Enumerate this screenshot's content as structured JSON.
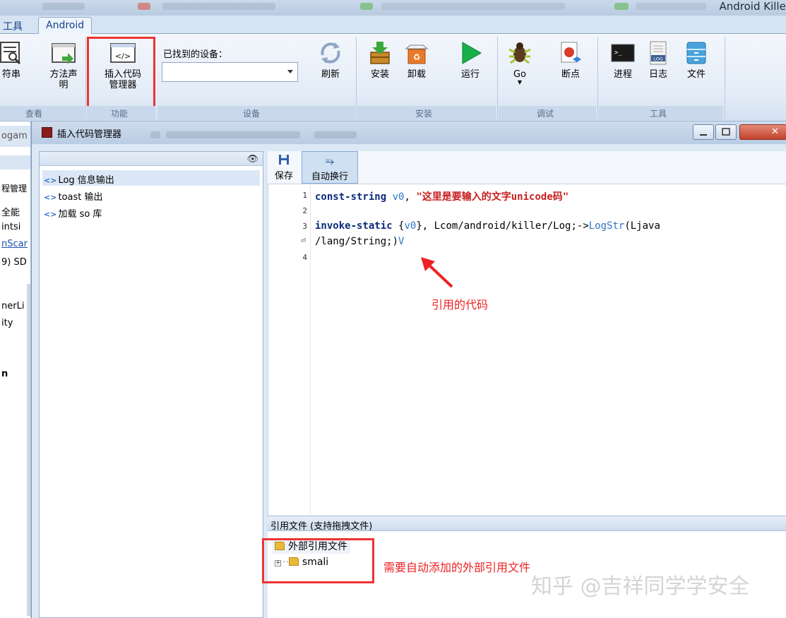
{
  "app": {
    "title_fragment": "Android Killer"
  },
  "ribbon": {
    "tabs": [
      {
        "label": "工具"
      },
      {
        "label": "Android"
      }
    ],
    "buttons": {
      "string_table": "符串",
      "method_declaration": "方法声明",
      "insert_code_line1": "插入代码",
      "insert_code_line2": "管理器",
      "refresh": "刷新",
      "install": "安装",
      "uninstall": "卸载",
      "run": "运行",
      "go": "Go",
      "breakpoint": "断点",
      "process": "进程",
      "log": "日志",
      "file": "文件"
    },
    "groups": {
      "view": "查看",
      "function": "功能",
      "device": "设备",
      "install": "安装",
      "debug": "调试",
      "tools": "工具"
    },
    "device_label": "已找到的设备：",
    "device_value": "",
    "log_icon_text": "LOG"
  },
  "left_strip": {
    "items": [
      "ogam",
      "程管理",
      "全能",
      "intsi",
      "nScar",
      "9) SD",
      "nerLi",
      "ity",
      "n"
    ]
  },
  "dialog": {
    "title": "插入代码管理器",
    "templates": [
      "Log 信息输出",
      "toast 输出",
      "加载 so 库"
    ],
    "toolbar": {
      "save": "保存",
      "word_wrap": "自动换行"
    },
    "code_lines": {
      "l1": {
        "op": "const-string",
        "reg": "v0",
        "sep": ",",
        "str": "\"这里是要输入的文字unicode码\""
      },
      "l3a": {
        "op": "invoke-static",
        "args_open": "{",
        "reg": "v0",
        "args_close": "}, Lcom/android/killer/Log;->",
        "meth": "LogStr",
        "tail": "(Ljava"
      },
      "l3b": {
        "tail": "/lang/String;)",
        "ret": "V"
      }
    },
    "line_numbers": [
      "1",
      "2",
      "3",
      "4"
    ],
    "ref_bar": "引用文件 (支持拖拽文件)",
    "ref_tree": {
      "root": "外部引用文件",
      "child": "smali"
    }
  },
  "annotations": {
    "code": "引用的代码",
    "files": "需要自动添加的外部引用文件"
  },
  "watermark": "知乎 @吉祥同学学安全"
}
